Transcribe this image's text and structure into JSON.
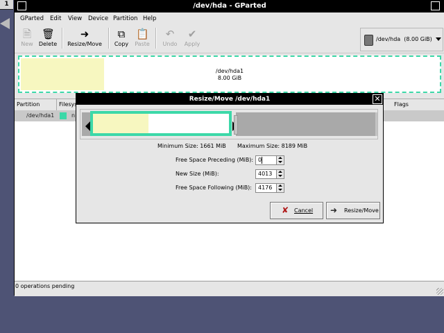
{
  "desktop": {
    "pager_number": "1"
  },
  "window": {
    "title": "/dev/hda - GParted"
  },
  "menu": [
    "GParted",
    "Edit",
    "View",
    "Device",
    "Partition",
    "Help"
  ],
  "toolbar": {
    "new": "New",
    "delete": "Delete",
    "resize_move": "Resize/Move",
    "copy": "Copy",
    "paste": "Paste",
    "undo": "Undo",
    "apply": "Apply"
  },
  "device_selector": {
    "value": "/dev/hda",
    "size": "(8.00 GiB)"
  },
  "disk_map": {
    "partition": "/dev/hda1",
    "size": "8.00 GiB"
  },
  "columns": {
    "partition": "Partition",
    "filesystem": "Filesys",
    "flags": "Flags"
  },
  "rows": [
    {
      "partition": "/dev/hda1",
      "fs_short": "n"
    }
  ],
  "status": "0 operations pending",
  "dialog": {
    "title": "Resize/Move /dev/hda1",
    "min_size": "Minimum Size: 1661 MiB",
    "max_size": "Maximum Size: 8189 MiB",
    "preceding_label": "Free Space Preceding (MiB):",
    "preceding_value": "0",
    "newsize_label": "New Size (MiB):",
    "newsize_value": "4013",
    "following_label": "Free Space Following (MiB):",
    "following_value": "4176",
    "cancel": "Cancel",
    "resize_move": "Resize/Move"
  },
  "colors": {
    "accent": "#3cd8a8",
    "used": "#f7f7c0",
    "unallocated": "#a9a9a9"
  }
}
